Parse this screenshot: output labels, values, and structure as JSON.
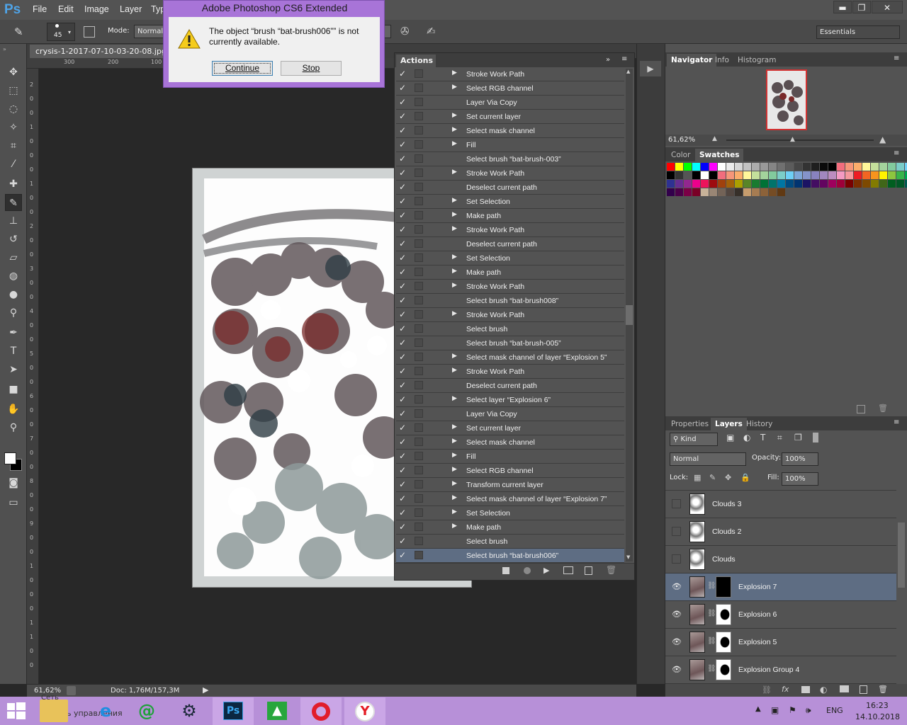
{
  "menubar": {
    "logo": "Ps",
    "items": [
      "File",
      "Edit",
      "Image",
      "Layer",
      "Typ"
    ],
    "window_controls": {
      "minimize": "▬",
      "restore": "❐",
      "close": "✕"
    }
  },
  "options": {
    "brush_size": "45",
    "mode_label": "Mode:",
    "mode_value": "Normal",
    "workspace": "Essentials"
  },
  "document": {
    "tab_title": "crysis-1-2017-07-10-03-20-08.jpg @",
    "ruler_top": [
      "300",
      "200",
      "100"
    ],
    "ruler_left": [
      "2",
      "0",
      "0",
      "1",
      "0",
      "0",
      "0",
      "1",
      "0",
      "0",
      "2",
      "0",
      "0",
      "3",
      "0",
      "0",
      "4",
      "0",
      "0",
      "5",
      "0",
      "0",
      "6",
      "0",
      "0",
      "7",
      "0",
      "0",
      "8",
      "0",
      "0",
      "9",
      "0",
      "0",
      "1",
      "0",
      "0",
      "0",
      "1",
      "1",
      "0",
      "0"
    ]
  },
  "status": {
    "zoom": "61,62%",
    "doc": "Doc: 1,76M/157,3M"
  },
  "dialog": {
    "title": "Adobe Photoshop CS6 Extended",
    "message": "The object “brush “bat-brush006”” is not currently available.",
    "continue": "Continue",
    "stop": "Stop"
  },
  "actions": {
    "tab": "Actions",
    "rows": [
      {
        "label": "Stroke Work Path",
        "tri": true
      },
      {
        "label": "Select RGB channel",
        "tri": true
      },
      {
        "label": "Layer Via Copy",
        "tri": false
      },
      {
        "label": "Set current layer",
        "tri": true
      },
      {
        "label": "Select mask channel",
        "tri": true
      },
      {
        "label": "Fill",
        "tri": true
      },
      {
        "label": "Select brush “bat-brush-003”",
        "tri": false
      },
      {
        "label": "Stroke Work Path",
        "tri": true
      },
      {
        "label": "Deselect current path",
        "tri": false
      },
      {
        "label": "Set Selection",
        "tri": true
      },
      {
        "label": "Make path",
        "tri": true
      },
      {
        "label": "Stroke Work Path",
        "tri": true
      },
      {
        "label": "Deselect current path",
        "tri": false
      },
      {
        "label": "Set Selection",
        "tri": true
      },
      {
        "label": "Make path",
        "tri": true
      },
      {
        "label": "Stroke Work Path",
        "tri": true
      },
      {
        "label": "Select brush “bat-brush008”",
        "tri": false
      },
      {
        "label": "Stroke Work Path",
        "tri": true
      },
      {
        "label": "Select brush",
        "tri": false
      },
      {
        "label": "Select brush “bat-brush-005”",
        "tri": false
      },
      {
        "label": "Select mask channel of layer “Explosion 5”",
        "tri": true
      },
      {
        "label": "Stroke Work Path",
        "tri": true
      },
      {
        "label": "Deselect current path",
        "tri": false
      },
      {
        "label": "Select layer “Explosion 6”",
        "tri": true
      },
      {
        "label": "Layer Via Copy",
        "tri": false
      },
      {
        "label": "Set current layer",
        "tri": true
      },
      {
        "label": "Select mask channel",
        "tri": true
      },
      {
        "label": "Fill",
        "tri": true
      },
      {
        "label": "Select RGB channel",
        "tri": true
      },
      {
        "label": "Transform current layer",
        "tri": true
      },
      {
        "label": "Select mask channel of layer “Explosion 7”",
        "tri": true
      },
      {
        "label": "Set Selection",
        "tri": true
      },
      {
        "label": "Make path",
        "tri": true
      },
      {
        "label": "Select brush",
        "tri": false
      },
      {
        "label": "Select brush “bat-brush006”",
        "tri": false,
        "selected": true
      }
    ]
  },
  "navigator": {
    "tabs": [
      "Navigator",
      "Info",
      "Histogram"
    ],
    "zoom": "61,62%"
  },
  "swatches_panel": {
    "tabs": [
      "Color",
      "Swatches"
    ]
  },
  "layers_panel": {
    "tabs": [
      "Properties",
      "Layers",
      "History"
    ],
    "kind": "Kind",
    "blend": "Normal",
    "opacity_label": "Opacity:",
    "opacity": "100%",
    "lock_label": "Lock:",
    "fill_label": "Fill:",
    "fill": "100%",
    "layers": [
      {
        "name": "Clouds 3",
        "visible": false,
        "mask": false
      },
      {
        "name": "Clouds 2",
        "visible": false,
        "mask": false
      },
      {
        "name": "Clouds",
        "visible": false,
        "mask": false
      },
      {
        "name": "Explosion 7",
        "visible": true,
        "mask": true,
        "selected": true
      },
      {
        "name": "Explosion 6",
        "visible": true,
        "mask": true
      },
      {
        "name": "Explosion 5",
        "visible": true,
        "mask": true
      },
      {
        "name": "Explosion Group 4",
        "visible": true,
        "mask": true
      }
    ]
  },
  "taskbar": {
    "net_label": "Сеть",
    "control_label": "Панель управления",
    "lang": "ENG",
    "time": "16:23",
    "date": "14.10.2018"
  },
  "colors": {
    "accent": "#4fa4e8",
    "selection": "#5e6d83",
    "taskbar": "#b790d8",
    "dialog_frame": "#a874d8"
  }
}
